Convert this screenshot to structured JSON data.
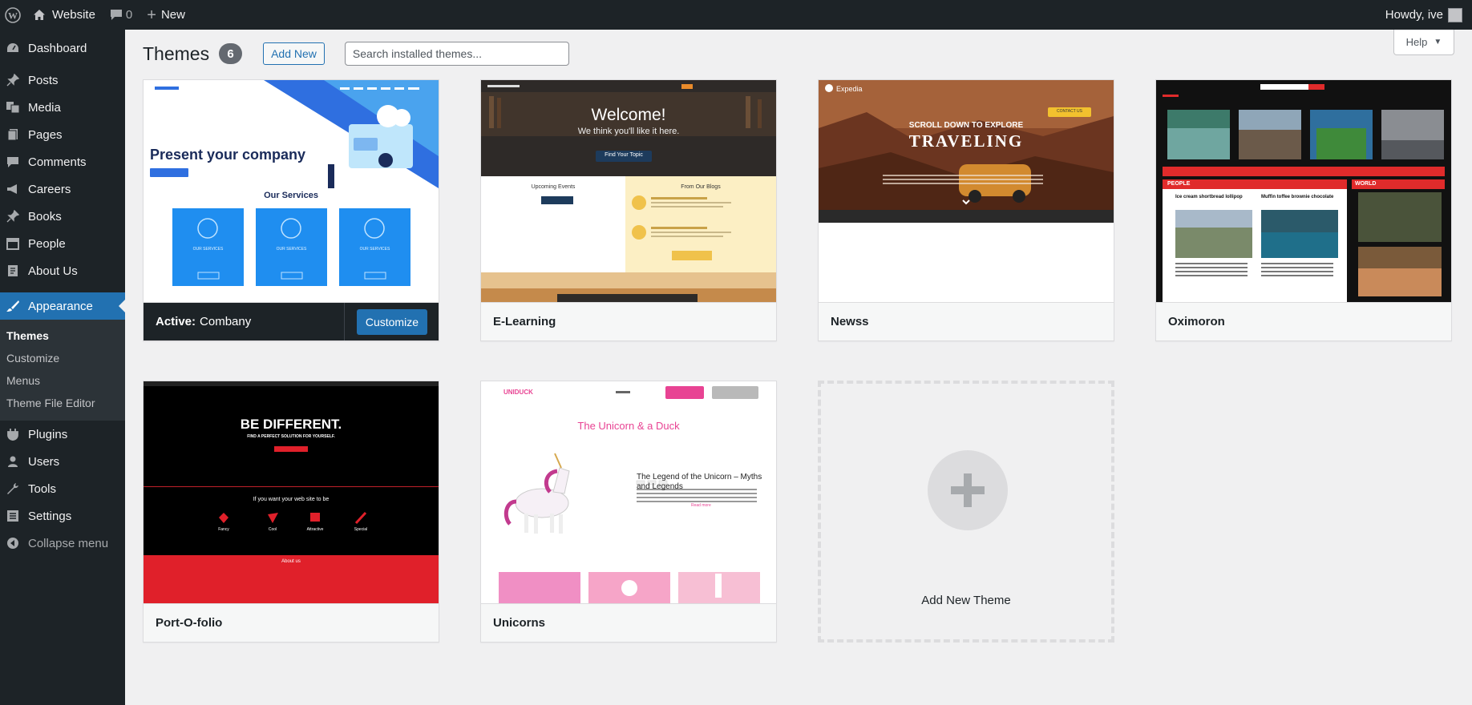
{
  "adminbar": {
    "site": "Website",
    "comments": "0",
    "new": "New",
    "howdy": "Howdy, ive"
  },
  "sidebar": {
    "items_top": [
      {
        "label": "Dashboard",
        "icon": "dashboard-icon"
      },
      {
        "label": "Posts",
        "icon": "pin-icon"
      },
      {
        "label": "Media",
        "icon": "media-icon"
      },
      {
        "label": "Pages",
        "icon": "pages-icon"
      },
      {
        "label": "Comments",
        "icon": "comment-icon"
      },
      {
        "label": "Careers",
        "icon": "megaphone-icon"
      },
      {
        "label": "Books",
        "icon": "pin-icon"
      },
      {
        "label": "People",
        "icon": "calendar-icon"
      },
      {
        "label": "About Us",
        "icon": "pages-icon"
      }
    ],
    "appearance": "Appearance",
    "submenu": [
      "Themes",
      "Customize",
      "Menus",
      "Theme File Editor"
    ],
    "items_bottom": [
      {
        "label": "Plugins",
        "icon": "plugin-icon"
      },
      {
        "label": "Users",
        "icon": "users-icon"
      },
      {
        "label": "Tools",
        "icon": "tools-icon"
      },
      {
        "label": "Settings",
        "icon": "settings-icon"
      }
    ],
    "collapse": "Collapse menu"
  },
  "header": {
    "title": "Themes",
    "count": "6",
    "add_new": "Add New",
    "search_placeholder": "Search installed themes...",
    "help": "Help"
  },
  "themes": [
    {
      "name": "Combany",
      "active_label": "Active:",
      "customize": "Customize",
      "preview": {
        "heading": "Present your company",
        "services": "Our Services",
        "card": "OUR SERVICES"
      }
    },
    {
      "name": "E-Learning",
      "preview": {
        "welcome": "Welcome!",
        "sub": "We think you'll like it here.",
        "cta": "Find Your Topic",
        "events": "Upcoming Events",
        "blogs": "From Our Blogs"
      }
    },
    {
      "name": "Newss",
      "preview": {
        "brand": "Expedia",
        "line1": "Scroll down to explore",
        "line2": "TRAVELING",
        "contact": "CONTACT US"
      }
    },
    {
      "name": "Oximoron",
      "preview": {
        "people": "PEOPLE",
        "world": "WORLD",
        "h1": "Ice cream shortbread lollipop",
        "h2": "Muffin toffee brownie chocolate"
      }
    },
    {
      "name": "Port-O-folio",
      "preview": {
        "heading": "BE DIFFERENT.",
        "sub": "FIND A PERFECT SOLUTION FOR YOURSELF.",
        "mid": "If you want your web site to be",
        "f1": "Fancy",
        "f2": "Cool",
        "f3": "Attractive",
        "f4": "Special",
        "about": "About us"
      }
    },
    {
      "name": "Unicorns",
      "preview": {
        "brand": "UNIDUCK",
        "title": "The Unicorn & a Duck",
        "post": "The Legend of the Unicorn – Myths and Legends",
        "read": "Read more"
      }
    }
  ],
  "add_new_theme": "Add New Theme",
  "colors": {
    "admin_dark": "#1d2327",
    "accent": "#2271b1",
    "bg": "#f0f0f1"
  }
}
